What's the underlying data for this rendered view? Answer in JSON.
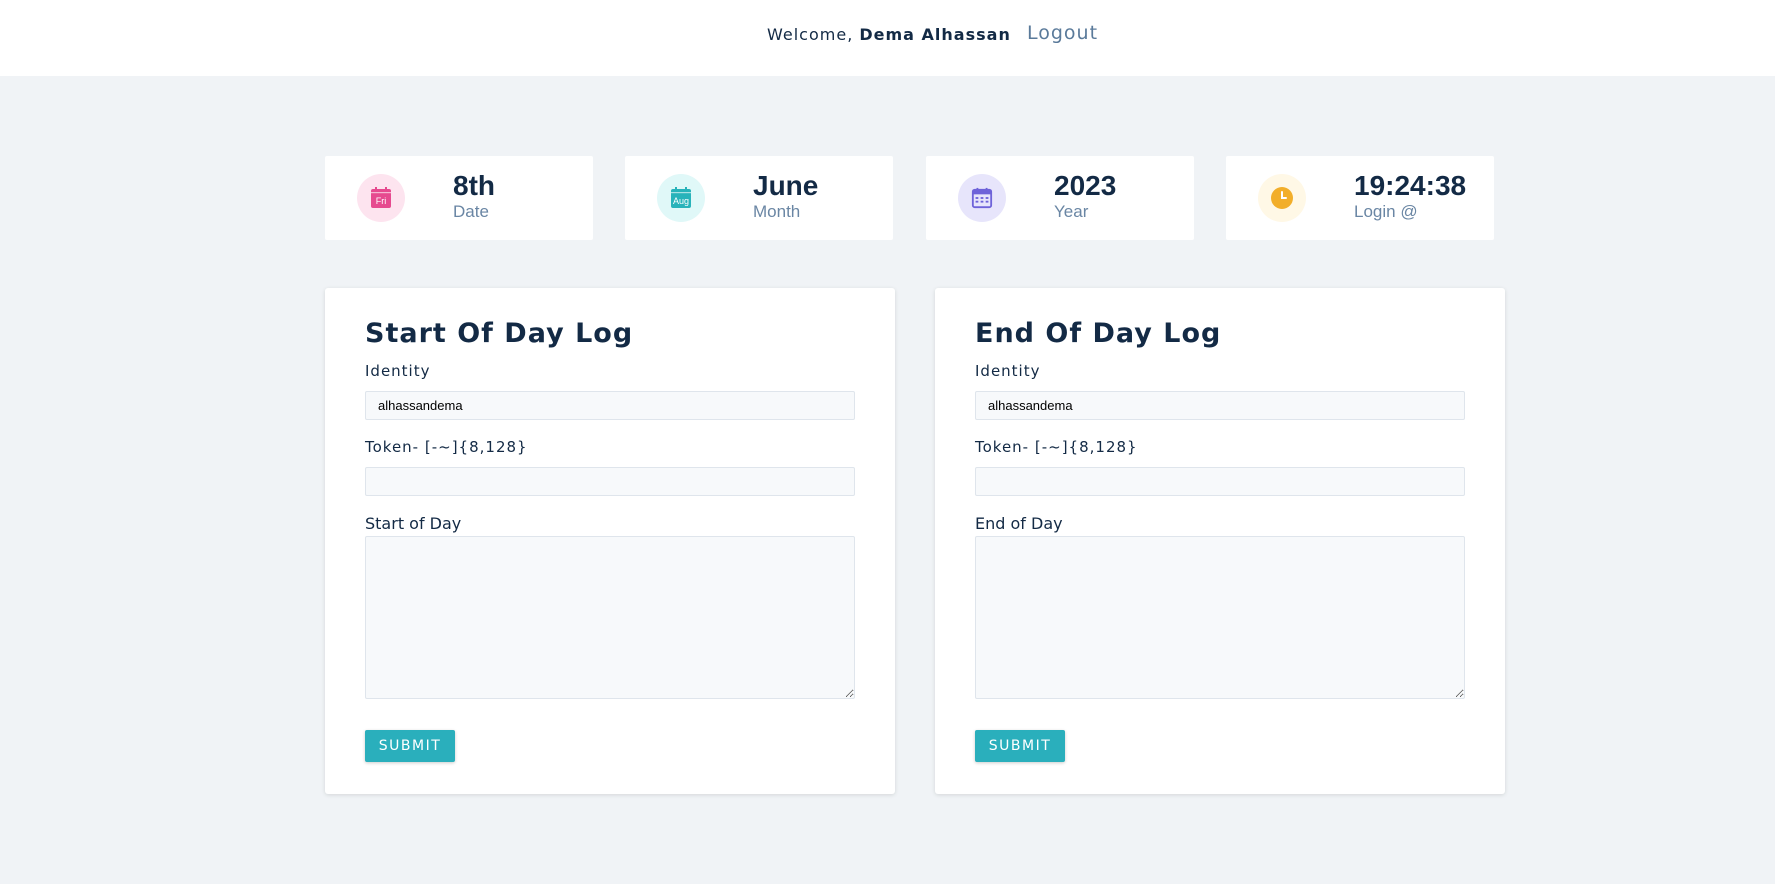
{
  "header": {
    "welcome_prefix": "Welcome,",
    "user_name": "Dema Alhassan",
    "logout_label": "Logout"
  },
  "stats": [
    {
      "icon": "calendar-fri-icon",
      "icon_text": "Fri",
      "value": "8th",
      "label": "Date",
      "accent": "#e64a8f",
      "bg": "#fde4ef"
    },
    {
      "icon": "calendar-aug-icon",
      "icon_text": "Aug",
      "value": "June",
      "label": "Month",
      "accent": "#28b3ba",
      "bg": "#e0f8f8"
    },
    {
      "icon": "calendar-grid-icon",
      "icon_text": "",
      "value": "2023",
      "label": "Year",
      "accent": "#6e63d9",
      "bg": "#e7e5fb"
    },
    {
      "icon": "clock-icon",
      "icon_text": "",
      "value": "19:24:38",
      "label": "Login @",
      "accent": "#f2ae2a",
      "bg": "#fff8e6"
    }
  ],
  "start_log": {
    "title": "Start Of Day Log",
    "identity_label": "Identity",
    "identity_value": "alhassandema",
    "token_label": "Token- [-~]{8,128}",
    "token_value": "",
    "notes_label": "Start of Day",
    "submit_label": "SUBMIT"
  },
  "end_log": {
    "title": "End Of Day Log",
    "identity_label": "Identity",
    "identity_value": "alhassandema",
    "token_label": "Token- [-~]{8,128}",
    "token_value": "",
    "notes_label": "End of Day",
    "submit_label": "SUBMIT"
  },
  "colors": {
    "accent": "#2aafbc",
    "text": "#132a45",
    "muted": "#6a86a4",
    "background": "#f0f3f6"
  }
}
